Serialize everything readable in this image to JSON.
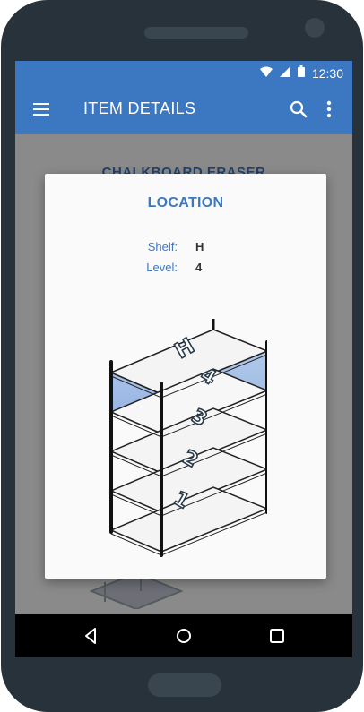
{
  "status_bar": {
    "time": "12:30"
  },
  "app_bar": {
    "title": "ITEM DETAILS"
  },
  "background": {
    "item_name": "CHALKBOARD ERASER"
  },
  "dialog": {
    "title": "LOCATION",
    "shelf_label": "Shelf:",
    "shelf_value": "H",
    "level_label": "Level:",
    "level_value": "4",
    "shelf_letter": "H",
    "levels": [
      "1",
      "2",
      "3",
      "4"
    ],
    "highlighted_level": "4"
  },
  "colors": {
    "accent": "#3c78c2",
    "highlight": "#8eaede",
    "scrim": "rgba(0,0,0,0.46)",
    "phone_body": "#27323a"
  },
  "icons": {
    "menu": "menu-icon",
    "search": "search-icon",
    "more": "more-vert-icon",
    "wifi": "wifi-icon",
    "signal": "signal-icon",
    "battery": "battery-icon",
    "back": "back-icon",
    "home": "home-icon",
    "recent": "recent-apps-icon"
  }
}
